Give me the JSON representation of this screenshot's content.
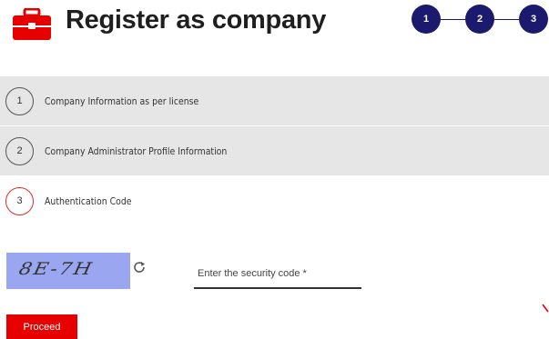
{
  "header": {
    "title": "Register as company",
    "icon": "briefcase-icon",
    "brand_color": "#e60000",
    "steps": [
      "1",
      "2",
      "3"
    ],
    "step_color": "#1b1a6e"
  },
  "accordion": {
    "items": [
      {
        "number": "1",
        "label": "Company Information as per license"
      },
      {
        "number": "2",
        "label": "Company Administrator Profile Information"
      },
      {
        "number": "3",
        "label": "Authentication Code"
      }
    ]
  },
  "auth": {
    "captcha_text": "8E-7H",
    "refresh_icon": "refresh-icon",
    "security_placeholder": "Enter the security code *",
    "security_value": ""
  },
  "actions": {
    "proceed_label": "Proceed"
  }
}
